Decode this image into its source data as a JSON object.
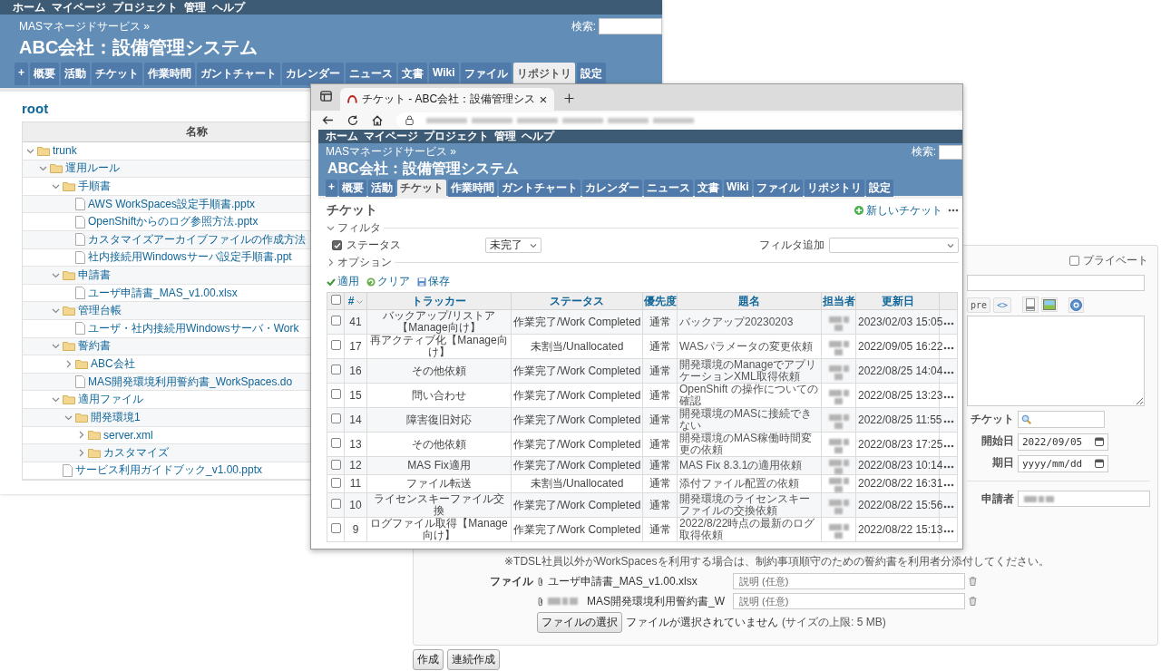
{
  "repository_window": {
    "top_menu": [
      "ホーム",
      "マイページ",
      "プロジェクト",
      "管理",
      "ヘルプ"
    ],
    "breadcrumb": "MASマネージドサービス »",
    "title": "ABC会社：設備管理システム",
    "search_label": "検索:",
    "tabs": [
      {
        "label": "+",
        "selected": false
      },
      {
        "label": "概要",
        "selected": false
      },
      {
        "label": "活動",
        "selected": false
      },
      {
        "label": "チケット",
        "selected": false
      },
      {
        "label": "作業時間",
        "selected": false
      },
      {
        "label": "ガントチャート",
        "selected": false
      },
      {
        "label": "カレンダー",
        "selected": false
      },
      {
        "label": "ニュース",
        "selected": false
      },
      {
        "label": "文書",
        "selected": false
      },
      {
        "label": "Wiki",
        "selected": false
      },
      {
        "label": "ファイル",
        "selected": false
      },
      {
        "label": "リポジトリ",
        "selected": true
      },
      {
        "label": "設定",
        "selected": false
      }
    ],
    "heading": "root",
    "tree_header": "名称",
    "tree": [
      {
        "kind": "folder",
        "name": "trunk",
        "expanded": true,
        "children": [
          {
            "kind": "folder",
            "name": "運用ルール",
            "expanded": true,
            "children": [
              {
                "kind": "folder",
                "name": "手順書",
                "expanded": true,
                "children": [
                  {
                    "kind": "file",
                    "name": "AWS WorkSpaces設定手順書.pptx"
                  },
                  {
                    "kind": "file",
                    "name": "OpenShiftからのログ参照方法.pptx"
                  },
                  {
                    "kind": "file",
                    "name": "カスタマイズアーカイブファイルの作成方法"
                  },
                  {
                    "kind": "file",
                    "name": "社内接続用Windowsサーバ設定手順書.ppt"
                  }
                ]
              },
              {
                "kind": "folder",
                "name": "申請書",
                "expanded": true,
                "children": [
                  {
                    "kind": "file",
                    "name": "ユーザ申請書_MAS_v1.00.xlsx"
                  }
                ]
              },
              {
                "kind": "folder",
                "name": "管理台帳",
                "expanded": true,
                "children": [
                  {
                    "kind": "file",
                    "name": "ユーザ・社内接続用Windowsサーバ・Work"
                  }
                ]
              },
              {
                "kind": "folder",
                "name": "誓約書",
                "expanded": true,
                "children": [
                  {
                    "kind": "folder",
                    "name": "ABC会社",
                    "expanded": false
                  },
                  {
                    "kind": "file",
                    "name": "MAS開発環境利用誓約書_WorkSpaces.do"
                  }
                ]
              },
              {
                "kind": "folder",
                "name": "適用ファイル",
                "expanded": true,
                "children": [
                  {
                    "kind": "folder",
                    "name": "開発環境1",
                    "expanded": true,
                    "children": [
                      {
                        "kind": "folder",
                        "name": "server.xml",
                        "expanded": false
                      },
                      {
                        "kind": "folder",
                        "name": "カスタマイズ",
                        "expanded": false
                      }
                    ]
                  }
                ]
              },
              {
                "kind": "file",
                "name": "サービス利用ガイドブック_v1.00.pptx"
              }
            ]
          }
        ]
      }
    ]
  },
  "ticket_browser": {
    "tab_title": "チケット - ABC会社：設備管理シス",
    "top_menu": [
      "ホーム",
      "マイページ",
      "プロジェクト",
      "管理",
      "ヘルプ"
    ],
    "breadcrumb": "MASマネージドサービス »",
    "title": "ABC会社：設備管理システム",
    "search_label": "検索:",
    "tabs": [
      {
        "label": "+",
        "selected": false
      },
      {
        "label": "概要",
        "selected": false
      },
      {
        "label": "活動",
        "selected": false
      },
      {
        "label": "チケット",
        "selected": true
      },
      {
        "label": "作業時間",
        "selected": false
      },
      {
        "label": "ガントチャート",
        "selected": false
      },
      {
        "label": "カレンダー",
        "selected": false
      },
      {
        "label": "ニュース",
        "selected": false
      },
      {
        "label": "文書",
        "selected": false
      },
      {
        "label": "Wiki",
        "selected": false
      },
      {
        "label": "ファイル",
        "selected": false
      },
      {
        "label": "リポジトリ",
        "selected": false
      },
      {
        "label": "設定",
        "selected": false
      }
    ],
    "heading": "チケット",
    "new_issue": "新しいチケット",
    "filter_legend": "フィルタ",
    "status_filter": {
      "label": "ステータス",
      "checked": true,
      "operator": "未完了"
    },
    "add_filter_label": "フィルタ追加",
    "options_legend": "オプション",
    "actions": [
      "適用",
      "クリア",
      "保存"
    ],
    "select_all_checked": false,
    "columns": [
      "#",
      "トラッカー",
      "ステータス",
      "優先度",
      "題名",
      "担当者",
      "更新日"
    ],
    "rows": [
      {
        "checked": false,
        "id": "41",
        "tracker": "バックアップ/リストア【Manage向け】",
        "status": "作業完了/Work Completed",
        "priority": "通常",
        "subject": "バックアップ20230203",
        "updated": "2023/02/03 15:05"
      },
      {
        "checked": false,
        "id": "17",
        "tracker": "再アクティブ化【Manage向け】",
        "status": "未割当/Unallocated",
        "priority": "通常",
        "subject": "WASパラメータの変更依頼",
        "updated": "2022/09/05 16:22"
      },
      {
        "checked": false,
        "id": "16",
        "tracker": "その他依頼",
        "status": "作業完了/Work Completed",
        "priority": "通常",
        "subject": "開発環境のManageでアプリケーションXML取得依頼",
        "updated": "2022/08/25 14:04"
      },
      {
        "checked": false,
        "id": "15",
        "tracker": "問い合わせ",
        "status": "作業完了/Work Completed",
        "priority": "通常",
        "subject": "OpenShift の操作についての確認",
        "updated": "2022/08/25 13:23"
      },
      {
        "checked": false,
        "id": "14",
        "tracker": "障害復旧対応",
        "status": "作業完了/Work Completed",
        "priority": "通常",
        "subject": "開発環境のMASに接続できない",
        "updated": "2022/08/25 11:55"
      },
      {
        "checked": false,
        "id": "13",
        "tracker": "その他依頼",
        "status": "作業完了/Work Completed",
        "priority": "通常",
        "subject": "開発環境のMAS稼働時間変更の依頼",
        "updated": "2022/08/23 17:25"
      },
      {
        "checked": false,
        "id": "12",
        "tracker": "MAS Fix適用",
        "status": "作業完了/Work Completed",
        "priority": "通常",
        "subject": "MAS Fix 8.3.1の適用依頼",
        "updated": "2022/08/23 10:14"
      },
      {
        "checked": false,
        "id": "11",
        "tracker": "ファイル転送",
        "status": "未割当/Unallocated",
        "priority": "通常",
        "subject": "添付ファイル配置の依頼",
        "updated": "2022/08/22 16:31"
      },
      {
        "checked": false,
        "id": "10",
        "tracker": "ライセンスキーファイル交換",
        "status": "作業完了/Work Completed",
        "priority": "通常",
        "subject": "開発環境のライセンスキーファイルの交換依頼",
        "updated": "2022/08/22 15:56"
      },
      {
        "checked": false,
        "id": "9",
        "tracker": "ログファイル取得【Manage向け】",
        "status": "作業完了/Work Completed",
        "priority": "通常",
        "subject": "2022/8/22時点の最新のログ取得依頼",
        "updated": "2022/08/22 15:13"
      }
    ]
  },
  "new_issue_form": {
    "private": {
      "label": "プライベート",
      "checked": false
    },
    "toolbar_buttons": [
      "pre",
      "<>"
    ],
    "related_issue_label": "チケット",
    "start_date": {
      "label": "開始日",
      "value": "2022/09/05"
    },
    "due_date": {
      "label": "期日",
      "placeholder": "yyyy/mm/dd"
    },
    "applicant_label": "申請者",
    "note": "※TDSL社員以外がWorkSpacesを利用する場合は、制約事項順守のための誓約書を利用者分添付してください。",
    "files_label": "ファイル",
    "attachments": [
      {
        "name": "ユーザ申請書_MAS_v1.00.xlsx",
        "redacted_prefix": false,
        "placeholder": "説明 (任意)"
      },
      {
        "name": "MAS開発環境利用誓約書_W",
        "redacted_prefix": true,
        "placeholder": "説明 (任意)"
      }
    ],
    "choose_button": "ファイルの選択",
    "no_file_text": "ファイルが選択されていません",
    "size_limit": "(サイズの上限: 5 MB)",
    "buttons": [
      "作成",
      "連続作成"
    ]
  }
}
